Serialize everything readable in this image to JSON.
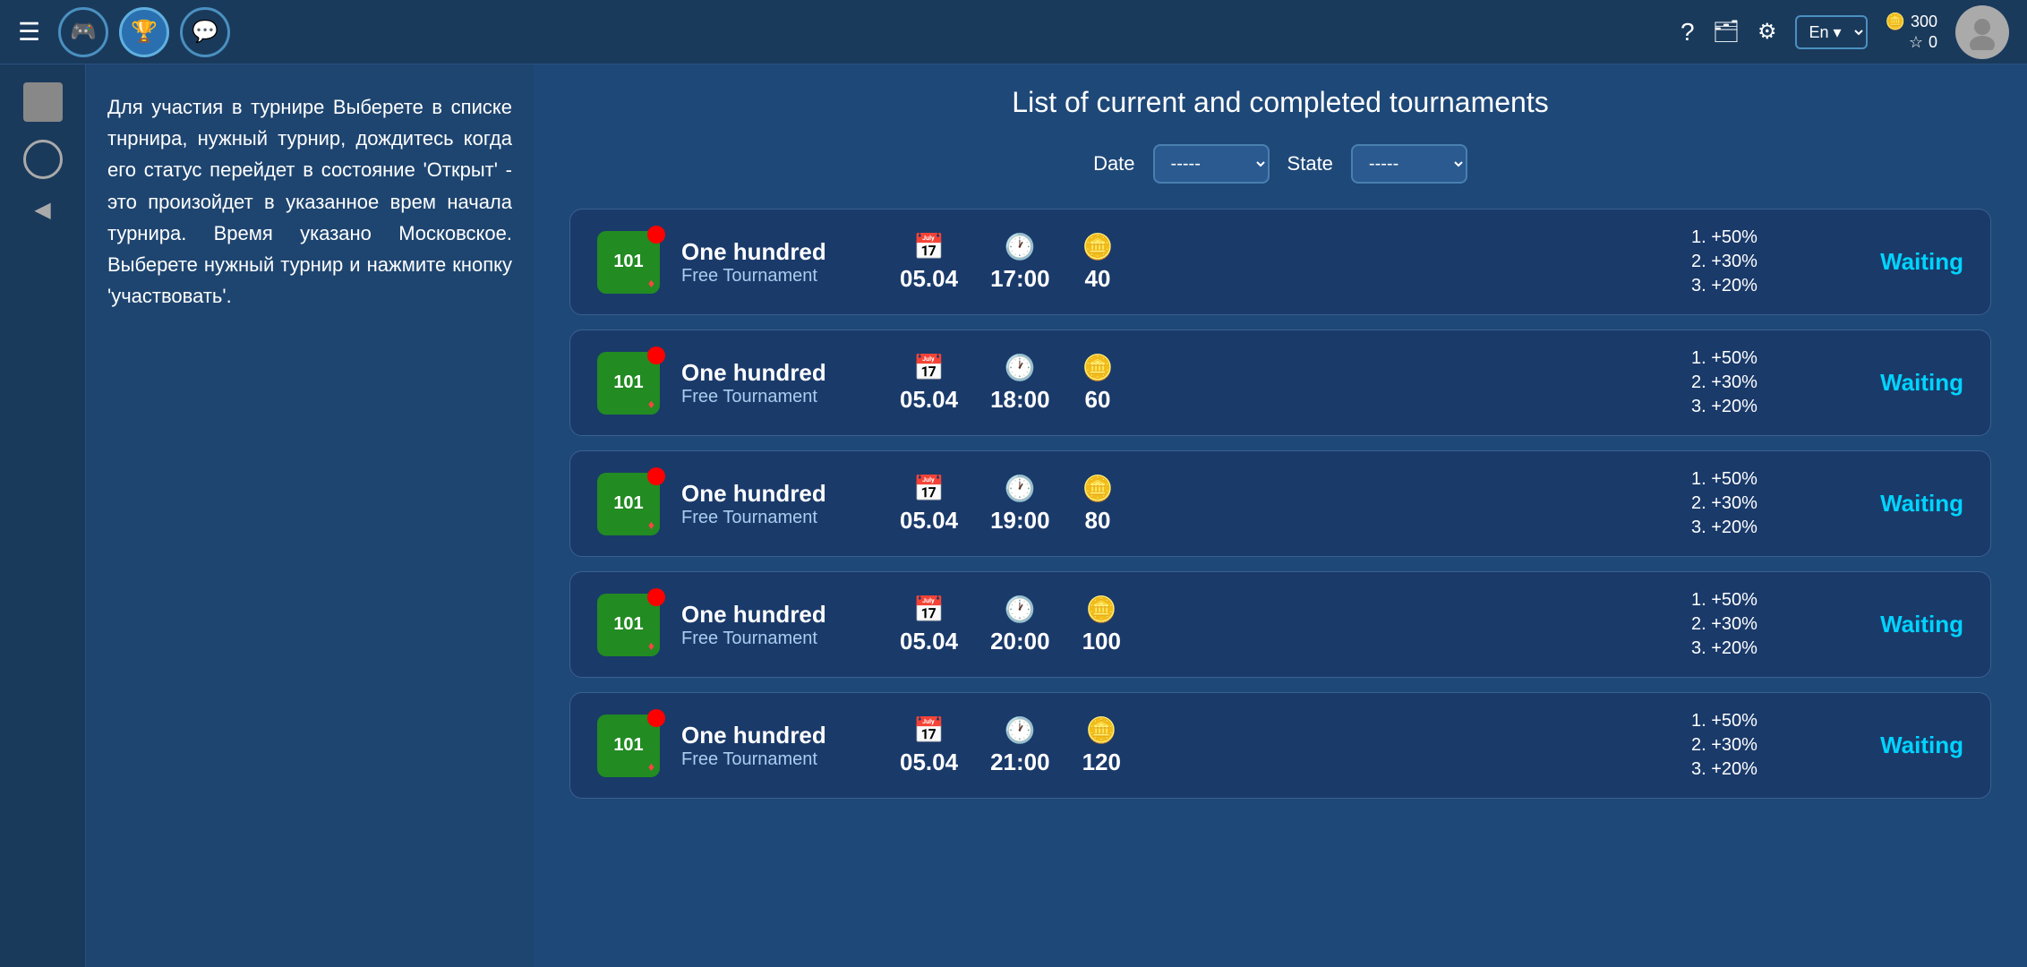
{
  "nav": {
    "hamburger": "☰",
    "icons": [
      {
        "name": "gamepad-icon",
        "symbol": "🎮",
        "active": false
      },
      {
        "name": "trophy-icon",
        "symbol": "🏆",
        "active": true
      },
      {
        "name": "chat-icon",
        "symbol": "💬",
        "active": false
      }
    ],
    "help_symbol": "?",
    "wallet_symbol": "🗂",
    "settings_symbol": "⚙",
    "lang_current": "En",
    "coins": "300",
    "stars": "0",
    "coins_icon": "🪙",
    "star_icon": "☆"
  },
  "sidebar": {
    "square_label": "",
    "circle_label": "",
    "arrow_label": "◀"
  },
  "info_panel": {
    "text": "Для участия в турнире Выберете в списке тнрнира, нужный турнир, дождитесь когда его статус перейдет в состояние 'Открыт' - это произойдет в указанное врем начала турнира. Время указано Московское. Выберете нужный турнир и нажмите кнопку 'участвовать'."
  },
  "main": {
    "page_title": "List of current and completed tournaments",
    "filters": {
      "date_label": "Date",
      "date_value": "-----",
      "state_label": "State",
      "state_value": "-----"
    },
    "tournaments": [
      {
        "id": 1,
        "icon_num": "101",
        "name": "One hundred",
        "sub": "Free Tournament",
        "date": "05.04",
        "time": "17:00",
        "capacity": "40",
        "prize1": "1. +50%",
        "prize2": "2. +30%",
        "prize3": "3. +20%",
        "status": "Waiting"
      },
      {
        "id": 2,
        "icon_num": "101",
        "name": "One hundred",
        "sub": "Free Tournament",
        "date": "05.04",
        "time": "18:00",
        "capacity": "60",
        "prize1": "1. +50%",
        "prize2": "2. +30%",
        "prize3": "3. +20%",
        "status": "Waiting"
      },
      {
        "id": 3,
        "icon_num": "101",
        "name": "One hundred",
        "sub": "Free Tournament",
        "date": "05.04",
        "time": "19:00",
        "capacity": "80",
        "prize1": "1. +50%",
        "prize2": "2. +30%",
        "prize3": "3. +20%",
        "status": "Waiting"
      },
      {
        "id": 4,
        "icon_num": "101",
        "name": "One hundred",
        "sub": "Free Tournament",
        "date": "05.04",
        "time": "20:00",
        "capacity": "100",
        "prize1": "1. +50%",
        "prize2": "2. +30%",
        "prize3": "3. +20%",
        "status": "Waiting"
      },
      {
        "id": 5,
        "icon_num": "101",
        "name": "One hundred",
        "sub": "Free Tournament",
        "date": "05.04",
        "time": "21:00",
        "capacity": "120",
        "prize1": "1. +50%",
        "prize2": "2. +30%",
        "prize3": "3. +20%",
        "status": "Waiting"
      }
    ]
  }
}
